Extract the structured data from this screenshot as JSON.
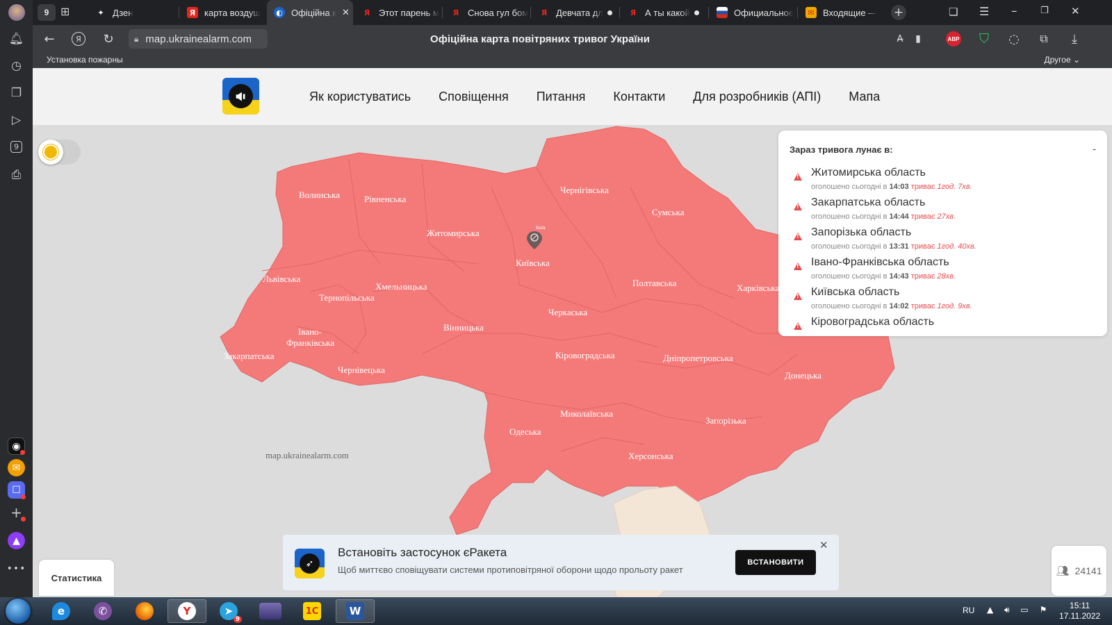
{
  "browser": {
    "tab_count_badge": "9",
    "tabs": [
      {
        "title": "Дзен",
        "fav": "✦",
        "fav_color": "#202124"
      },
      {
        "title": "карта воздуш",
        "fav": "Я",
        "fav_color": "#e52620"
      },
      {
        "title": "Офіційна к",
        "fav": "◐",
        "fav_color": "#1b64c8",
        "active": true
      },
      {
        "title": "Этот парень м",
        "fav": "Я",
        "fav_color": "#202124",
        "dot": false
      },
      {
        "title": "Снова гул бом",
        "fav": "Я",
        "fav_color": "#202124"
      },
      {
        "title": "Девчата дл",
        "fav": "Я",
        "fav_color": "#202124",
        "dot": true
      },
      {
        "title": "А ты какой",
        "fav": "Я",
        "fav_color": "#202124",
        "dot": true
      },
      {
        "title": "Официальное",
        "fav": "▬",
        "fav_color": "#2451a8"
      },
      {
        "title": "Входящие — ",
        "fav": "✉",
        "fav_color": "#f0a800"
      }
    ],
    "url": "map.ukrainealarm.com",
    "page_title": "Офіційна карта повітряних тривог України",
    "bookmark": "Установка пожарны",
    "other_bookmarks": "Другое ⌄",
    "abp_badge": "ABP"
  },
  "site": {
    "nav": [
      "Як користуватись",
      "Сповіщення",
      "Питання",
      "Контакти",
      "Для розробників (АПІ)",
      "Мапа"
    ]
  },
  "map": {
    "watermark": "map.ukrainealarm.com",
    "city_label": "Київ",
    "region_fill": "#f47a7a",
    "sea_fill": "#dcdcdc",
    "crimea_fill": "#f3e6d6",
    "regions": [
      {
        "name": "Волинська"
      },
      {
        "name": "Рівненська"
      },
      {
        "name": "Житомирська"
      },
      {
        "name": "Чернігівська"
      },
      {
        "name": "Сумська"
      },
      {
        "name": "Київська"
      },
      {
        "name": "Львівська"
      },
      {
        "name": "Тернопільська"
      },
      {
        "name": "Хмельницька"
      },
      {
        "name": "Полтавська"
      },
      {
        "name": "Харківська"
      },
      {
        "name": "Івано-"
      },
      {
        "name": "Франківська"
      },
      {
        "name": "Черкаська"
      },
      {
        "name": "Вінницька"
      },
      {
        "name": "Закарпатська"
      },
      {
        "name": "Чернівецька"
      },
      {
        "name": "Кіровоградська"
      },
      {
        "name": "Дніпропетровська"
      },
      {
        "name": "Донецька"
      },
      {
        "name": "Миколаївська"
      },
      {
        "name": "Одеська"
      },
      {
        "name": "Запорізька"
      },
      {
        "name": "Херсонська"
      }
    ]
  },
  "alerts": {
    "header": "Зараз тривога лунає в:",
    "collapse": "-",
    "items": [
      {
        "name": "Житомирська область",
        "prefix": "оголошено сьогодні в",
        "time": "14:03",
        "lasting": "триває",
        "duration": "1год. 7хв."
      },
      {
        "name": "Закарпатська область",
        "prefix": "оголошено сьогодні в",
        "time": "14:44",
        "lasting": "триває",
        "duration": "27хв."
      },
      {
        "name": "Запорізька область",
        "prefix": "оголошено сьогодні в",
        "time": "13:31",
        "lasting": "триває",
        "duration": "1год. 40хв."
      },
      {
        "name": "Івано-Франківська область",
        "prefix": "оголошено сьогодні в",
        "time": "14:43",
        "lasting": "триває",
        "duration": "28хв."
      },
      {
        "name": "Київська область",
        "prefix": "оголошено сьогодні в",
        "time": "14:02",
        "lasting": "триває",
        "duration": "1год. 9хв."
      },
      {
        "name": "Кіровоградська область",
        "prefix": "",
        "time": "",
        "lasting": "",
        "duration": ""
      }
    ]
  },
  "banner": {
    "title": "Встановіть застосунок єРакета",
    "subtitle": "Щоб миттєво сповіщувати системи протиповітряної оборони щодо прольоту ракет",
    "install": "ВСТАНОВИТИ",
    "close": "✕"
  },
  "stats_label": "Статистика",
  "viewers_count": "24141",
  "taskbar": {
    "lang": "RU",
    "time": "15:11",
    "date": "17.11.2022",
    "telegram_badge": "9"
  }
}
